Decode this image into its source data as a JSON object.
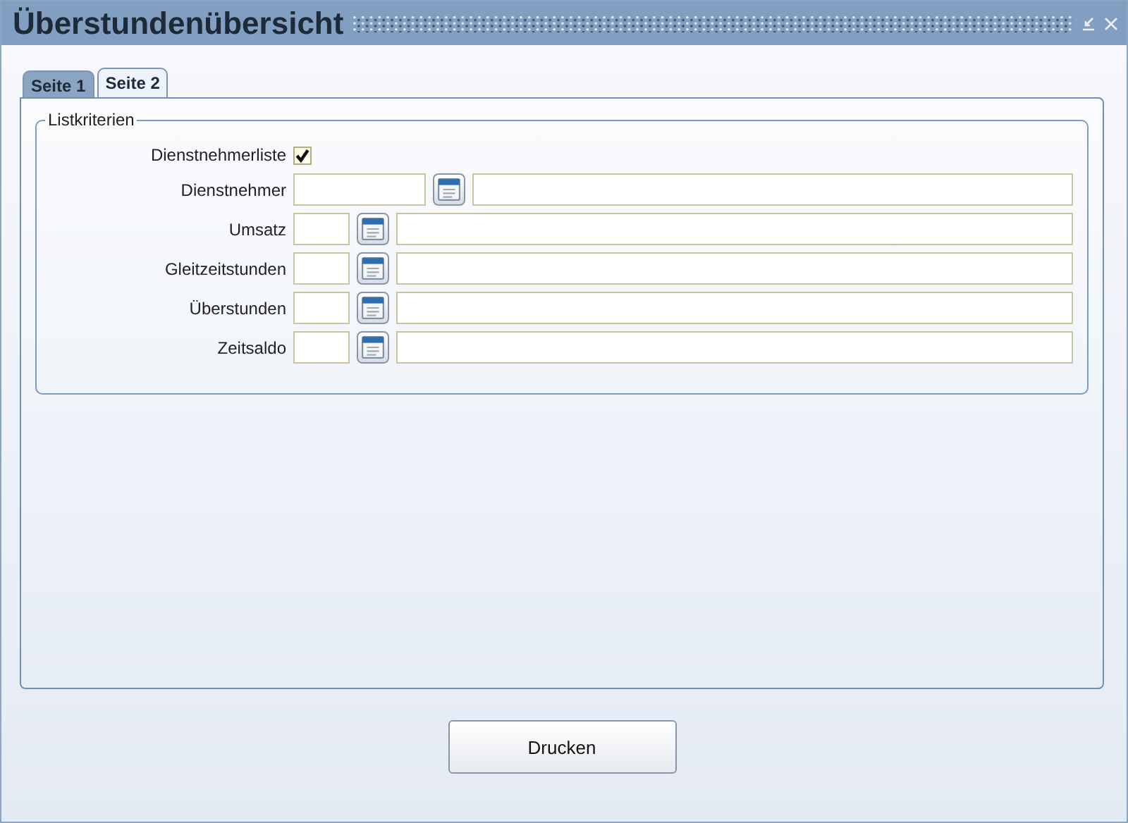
{
  "window": {
    "title": "Überstundenübersicht"
  },
  "tabs": [
    {
      "label": "Seite 1",
      "selected": false
    },
    {
      "label": "Seite 2",
      "selected": true
    }
  ],
  "group": {
    "title": "Listkriterien",
    "checkbox": {
      "label": "Dienstnehmerliste",
      "checked": true
    },
    "rows": [
      {
        "label": "Dienstnehmer",
        "kind": "wide"
      },
      {
        "label": "Umsatz",
        "kind": "narrow"
      },
      {
        "label": "Gleitzeitstunden",
        "kind": "narrow"
      },
      {
        "label": "Überstunden",
        "kind": "narrow"
      },
      {
        "label": "Zeitsaldo",
        "kind": "narrow"
      }
    ]
  },
  "buttons": [
    {
      "label": "Drucken"
    }
  ]
}
